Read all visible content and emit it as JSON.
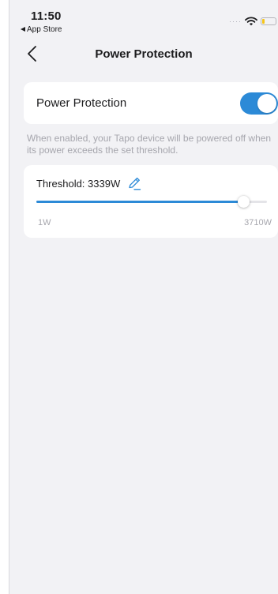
{
  "status_bar": {
    "time": "11:50",
    "back_app": "App Store",
    "battery_level": 0.25,
    "battery_color": "#f5c518"
  },
  "nav": {
    "title": "Power Protection",
    "back_icon": "chevron-left-icon"
  },
  "power_protection": {
    "label": "Power Protection",
    "enabled": true,
    "description": "When enabled, your Tapo device will be powered off when its power exceeds the set threshold."
  },
  "threshold": {
    "label": "Threshold: 3339W",
    "value": 3339,
    "min": 1,
    "max": 3710,
    "min_label": "1W",
    "max_label": "3710W",
    "edit_icon": "pencil-icon"
  },
  "colors": {
    "accent": "#2c8ad7",
    "background": "#f2f2f5",
    "card": "#ffffff",
    "secondary_text": "#a6a6ad"
  }
}
